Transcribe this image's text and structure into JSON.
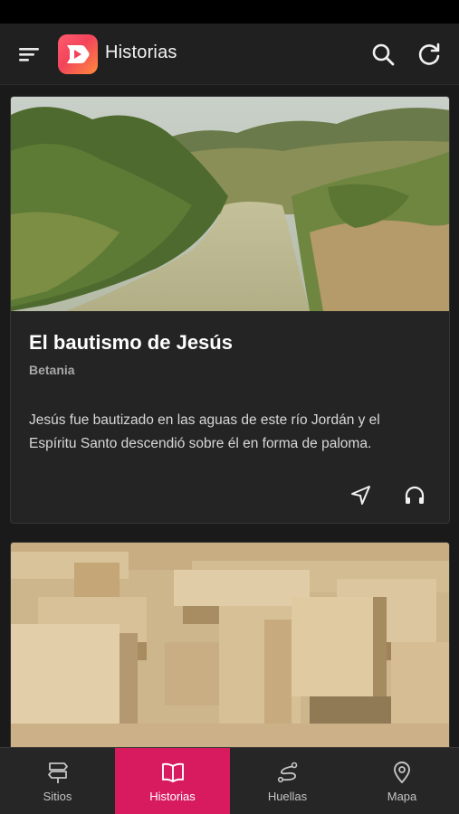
{
  "app_bar": {
    "title": "Historias",
    "icons": [
      "menu-icon",
      "app-logo",
      "search-icon",
      "refresh-icon"
    ]
  },
  "stories": [
    {
      "image": "river-jordan-photo",
      "title": "El bautismo de Jesús",
      "location": "Betania",
      "description": "Jesús fue bautizado en las aguas de este río Jordán y el Espíritu Santo descendió sobre él en forma de paloma.",
      "actions": [
        "navigate-icon",
        "headphones-icon"
      ]
    },
    {
      "image": "ruins-photo"
    }
  ],
  "bottom_nav": {
    "active_index": 1,
    "active_color": "#d81b5e",
    "items": [
      {
        "label": "Sitios",
        "icon": "signpost-icon"
      },
      {
        "label": "Historias",
        "icon": "open-book-icon"
      },
      {
        "label": "Huellas",
        "icon": "path-icon"
      },
      {
        "label": "Mapa",
        "icon": "map-pin-icon"
      }
    ]
  }
}
